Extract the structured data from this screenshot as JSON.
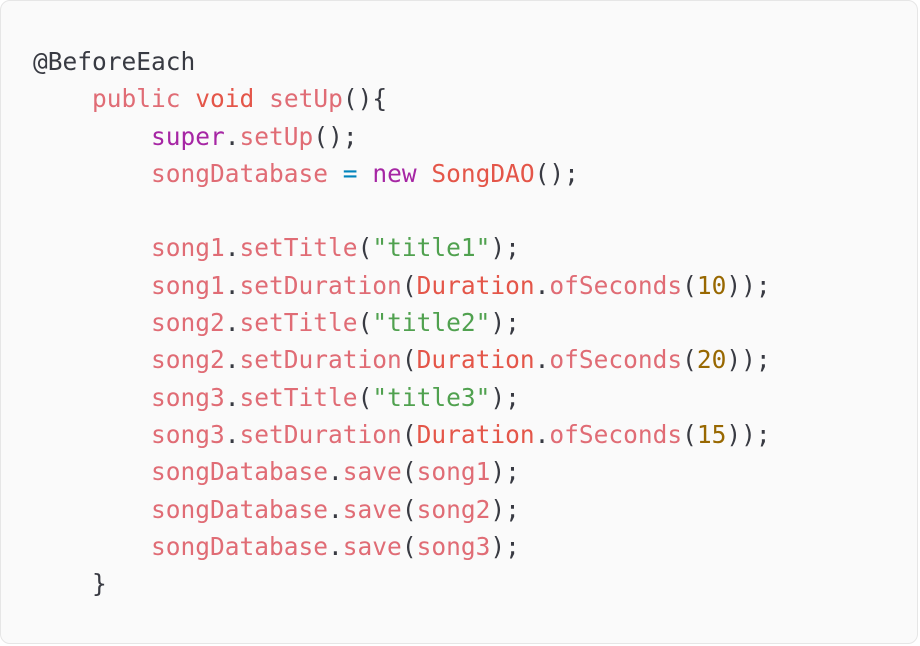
{
  "colors": {
    "background": "#fafafa",
    "default": "#383a42",
    "keyword_red": "#e45649",
    "identifier": "#e06c75",
    "magenta": "#a626a4",
    "string": "#50a14f",
    "number": "#986801",
    "operator": "#0184bc"
  },
  "code": {
    "language": "java",
    "lines": [
      [
        {
          "text": "@BeforeEach",
          "color": "#383a42"
        }
      ],
      [
        {
          "text": "    "
        },
        {
          "text": "public",
          "color": "#e06c75"
        },
        {
          "text": " "
        },
        {
          "text": "void",
          "color": "#e45649"
        },
        {
          "text": " "
        },
        {
          "text": "setUp",
          "color": "#e06c75"
        },
        {
          "text": "(){",
          "color": "#383a42"
        }
      ],
      [
        {
          "text": "        "
        },
        {
          "text": "super",
          "color": "#a626a4"
        },
        {
          "text": ".",
          "color": "#383a42"
        },
        {
          "text": "setUp",
          "color": "#e06c75"
        },
        {
          "text": "();",
          "color": "#383a42"
        }
      ],
      [
        {
          "text": "        "
        },
        {
          "text": "songDatabase",
          "color": "#e06c75"
        },
        {
          "text": " "
        },
        {
          "text": "=",
          "color": "#0184bc"
        },
        {
          "text": " "
        },
        {
          "text": "new",
          "color": "#a626a4"
        },
        {
          "text": " "
        },
        {
          "text": "SongDAO",
          "color": "#e45649"
        },
        {
          "text": "();",
          "color": "#383a42"
        }
      ],
      [],
      [
        {
          "text": "        "
        },
        {
          "text": "song1",
          "color": "#e06c75"
        },
        {
          "text": ".",
          "color": "#383a42"
        },
        {
          "text": "setTitle",
          "color": "#e06c75"
        },
        {
          "text": "(",
          "color": "#383a42"
        },
        {
          "text": "\"title1\"",
          "color": "#50a14f"
        },
        {
          "text": ");",
          "color": "#383a42"
        }
      ],
      [
        {
          "text": "        "
        },
        {
          "text": "song1",
          "color": "#e06c75"
        },
        {
          "text": ".",
          "color": "#383a42"
        },
        {
          "text": "setDuration",
          "color": "#e06c75"
        },
        {
          "text": "(",
          "color": "#383a42"
        },
        {
          "text": "Duration",
          "color": "#e45649"
        },
        {
          "text": ".",
          "color": "#383a42"
        },
        {
          "text": "ofSeconds",
          "color": "#e06c75"
        },
        {
          "text": "(",
          "color": "#383a42"
        },
        {
          "text": "10",
          "color": "#986801"
        },
        {
          "text": "));",
          "color": "#383a42"
        }
      ],
      [
        {
          "text": "        "
        },
        {
          "text": "song2",
          "color": "#e06c75"
        },
        {
          "text": ".",
          "color": "#383a42"
        },
        {
          "text": "setTitle",
          "color": "#e06c75"
        },
        {
          "text": "(",
          "color": "#383a42"
        },
        {
          "text": "\"title2\"",
          "color": "#50a14f"
        },
        {
          "text": ");",
          "color": "#383a42"
        }
      ],
      [
        {
          "text": "        "
        },
        {
          "text": "song2",
          "color": "#e06c75"
        },
        {
          "text": ".",
          "color": "#383a42"
        },
        {
          "text": "setDuration",
          "color": "#e06c75"
        },
        {
          "text": "(",
          "color": "#383a42"
        },
        {
          "text": "Duration",
          "color": "#e45649"
        },
        {
          "text": ".",
          "color": "#383a42"
        },
        {
          "text": "ofSeconds",
          "color": "#e06c75"
        },
        {
          "text": "(",
          "color": "#383a42"
        },
        {
          "text": "20",
          "color": "#986801"
        },
        {
          "text": "));",
          "color": "#383a42"
        }
      ],
      [
        {
          "text": "        "
        },
        {
          "text": "song3",
          "color": "#e06c75"
        },
        {
          "text": ".",
          "color": "#383a42"
        },
        {
          "text": "setTitle",
          "color": "#e06c75"
        },
        {
          "text": "(",
          "color": "#383a42"
        },
        {
          "text": "\"title3\"",
          "color": "#50a14f"
        },
        {
          "text": ");",
          "color": "#383a42"
        }
      ],
      [
        {
          "text": "        "
        },
        {
          "text": "song3",
          "color": "#e06c75"
        },
        {
          "text": ".",
          "color": "#383a42"
        },
        {
          "text": "setDuration",
          "color": "#e06c75"
        },
        {
          "text": "(",
          "color": "#383a42"
        },
        {
          "text": "Duration",
          "color": "#e45649"
        },
        {
          "text": ".",
          "color": "#383a42"
        },
        {
          "text": "ofSeconds",
          "color": "#e06c75"
        },
        {
          "text": "(",
          "color": "#383a42"
        },
        {
          "text": "15",
          "color": "#986801"
        },
        {
          "text": "));",
          "color": "#383a42"
        }
      ],
      [
        {
          "text": "        "
        },
        {
          "text": "songDatabase",
          "color": "#e06c75"
        },
        {
          "text": ".",
          "color": "#383a42"
        },
        {
          "text": "save",
          "color": "#e06c75"
        },
        {
          "text": "(",
          "color": "#383a42"
        },
        {
          "text": "song1",
          "color": "#e06c75"
        },
        {
          "text": ");",
          "color": "#383a42"
        }
      ],
      [
        {
          "text": "        "
        },
        {
          "text": "songDatabase",
          "color": "#e06c75"
        },
        {
          "text": ".",
          "color": "#383a42"
        },
        {
          "text": "save",
          "color": "#e06c75"
        },
        {
          "text": "(",
          "color": "#383a42"
        },
        {
          "text": "song2",
          "color": "#e06c75"
        },
        {
          "text": ");",
          "color": "#383a42"
        }
      ],
      [
        {
          "text": "        "
        },
        {
          "text": "songDatabase",
          "color": "#e06c75"
        },
        {
          "text": ".",
          "color": "#383a42"
        },
        {
          "text": "save",
          "color": "#e06c75"
        },
        {
          "text": "(",
          "color": "#383a42"
        },
        {
          "text": "song3",
          "color": "#e06c75"
        },
        {
          "text": ");",
          "color": "#383a42"
        }
      ],
      [
        {
          "text": "    "
        },
        {
          "text": "}",
          "color": "#383a42"
        }
      ]
    ]
  }
}
